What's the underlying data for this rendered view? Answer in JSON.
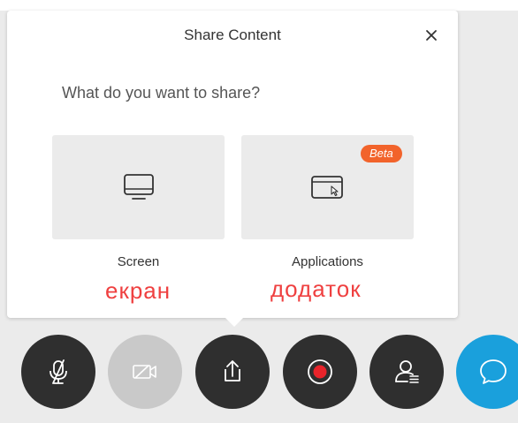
{
  "share_panel": {
    "title": "Share Content",
    "question": "What do you want to share?",
    "options": [
      {
        "label": "Screen",
        "annotation": "екран"
      },
      {
        "label": "Applications",
        "badge": "Beta",
        "annotation": "додаток"
      }
    ]
  },
  "controls": [
    {
      "name": "mute-microphone",
      "icon": "microphone-off-icon"
    },
    {
      "name": "video",
      "icon": "camera-off-icon",
      "state": "disabled"
    },
    {
      "name": "share",
      "icon": "share-icon",
      "state": "active"
    },
    {
      "name": "record",
      "icon": "record-icon"
    },
    {
      "name": "participants",
      "icon": "participants-icon"
    },
    {
      "name": "chat",
      "icon": "chat-icon"
    }
  ],
  "colors": {
    "accent_badge": "#f2632b",
    "annotation_text": "#ef4040",
    "record_dot": "#e8232a",
    "chat_button": "#1aa0dc",
    "control_button": "#2f2f2f",
    "control_disabled": "#c9c9c9"
  }
}
